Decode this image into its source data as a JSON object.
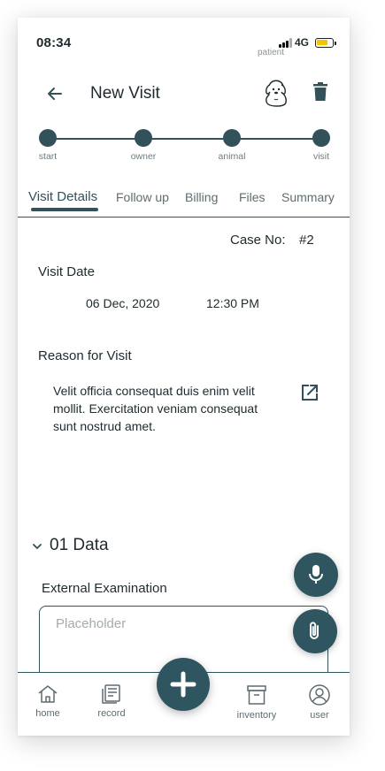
{
  "status_bar": {
    "time": "08:34",
    "network": "4G",
    "patient_tag": "patient"
  },
  "header": {
    "title": "New Visit"
  },
  "stepper": {
    "steps": [
      {
        "label": "start"
      },
      {
        "label": "owner"
      },
      {
        "label": "animal"
      },
      {
        "label": "visit"
      }
    ]
  },
  "tabs": [
    {
      "label": "Visit Details",
      "active": true
    },
    {
      "label": "Follow up"
    },
    {
      "label": "Billing"
    },
    {
      "label": "Files"
    },
    {
      "label": "Summary"
    }
  ],
  "visit": {
    "case_label": "Case No:",
    "case_value": "#2",
    "date_label": "Visit Date",
    "date": "06 Dec, 2020",
    "time": "12:30 PM",
    "reason_label": "Reason for Visit",
    "reason_text": "Velit officia consequat duis enim velit mollit. Exercitation veniam consequat sunt nostrud amet."
  },
  "data_section": {
    "title": "01 Data",
    "field_label": "External Examination",
    "placeholder": "Placeholder"
  },
  "bottom_nav": {
    "items": [
      {
        "label": "home",
        "icon": "home-icon"
      },
      {
        "label": "record",
        "icon": "record-icon"
      },
      {
        "label": "inventory",
        "icon": "inventory-icon"
      },
      {
        "label": "user",
        "icon": "user-icon"
      }
    ]
  },
  "colors": {
    "primary": "#2f5560",
    "accent": "#33515a",
    "battery": "#f5c400"
  }
}
